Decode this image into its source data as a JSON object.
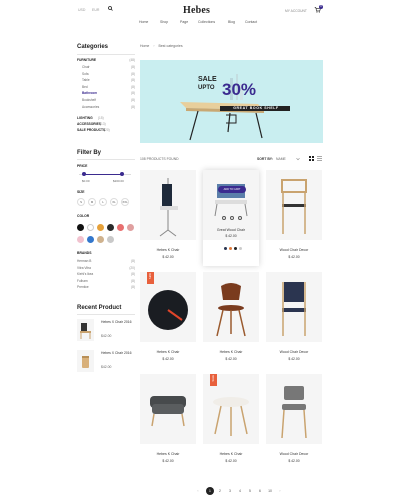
{
  "topbar": {
    "lang": "USD",
    "curr": "EUR",
    "logo": "Hebes",
    "account": "MY ACCOUNT",
    "cart_count": "0",
    "nav": [
      "Home",
      "Shop",
      "Page",
      "Collections",
      "Blog",
      "Contact"
    ]
  },
  "breadcrumb": {
    "home": "Home",
    "current": "Best categories"
  },
  "sidebar": {
    "categories_title": "Categories",
    "furniture": "FURNITURE",
    "furniture_count": "(48)",
    "subcats": [
      {
        "label": "Chair",
        "count": "(8)"
      },
      {
        "label": "Sofa",
        "count": "(8)"
      },
      {
        "label": "Table",
        "count": "(8)"
      },
      {
        "label": "Bed",
        "count": "(8)"
      },
      {
        "label": "Bathroom",
        "count": "(8)"
      },
      {
        "label": "Bookshelf",
        "count": "(8)"
      },
      {
        "label": "Accessories",
        "count": "(8)"
      }
    ],
    "other_cats": [
      {
        "label": "LIGHTING",
        "count": "(15)"
      },
      {
        "label": "ACCESSORIES",
        "count": "(13)"
      },
      {
        "label": "SALE PRODUCTS",
        "count": "(20)"
      }
    ],
    "filter_title": "Filter By",
    "price_label": "PRICE",
    "price_min": "$0.00",
    "price_max": "$200.00",
    "size_label": "SIZE",
    "sizes": [
      "S",
      "M",
      "L",
      "XL",
      "XXL"
    ],
    "color_label": "COLOR",
    "colors": [
      "#111111",
      "#ffffff",
      "#e6a13a",
      "#2a2a2a",
      "#e86f6f",
      "#e0a0a0",
      "#f1c2cf",
      "#3377cc",
      "#cfb28e",
      "#c9c9c9"
    ],
    "brands_label": "BRANDS",
    "brands": [
      {
        "label": "Herman B",
        "count": "(8)"
      },
      {
        "label": "Vitra Vitra",
        "count": "(20)"
      },
      {
        "label": "Kiehl's Ikea",
        "count": "(8)"
      },
      {
        "label": "Fulham",
        "count": "(8)"
      },
      {
        "label": "Prentice",
        "count": "(8)"
      }
    ],
    "recent_title": "Recent Product",
    "recent": [
      {
        "name": "Hebes X Chair 2016",
        "price": "$42.00"
      },
      {
        "name": "Hebes X Chair 2016",
        "price": "$42.00"
      }
    ]
  },
  "banner": {
    "line1": "SALE",
    "line2": "UPTO",
    "pct": "30%",
    "sub": "GREAT BOOK SHELF"
  },
  "toolbar": {
    "found": "108 PRODUCTS FOUND",
    "sortby": "SORT BY:",
    "sortval": "NAME"
  },
  "products": [
    {
      "name": "Hebes K Chair",
      "price": "$ 42.00"
    },
    {
      "name": "Great Wood Chair",
      "price": "$ 42.00",
      "cta": "ADD TO CART"
    },
    {
      "name": "Wood Chair Decor",
      "price": "$ 42.00"
    },
    {
      "name": "Hebes K Chair",
      "price": "$ 42.00",
      "badge": "NEW"
    },
    {
      "name": "Hebes K Chair",
      "price": "$ 42.00"
    },
    {
      "name": "Wood Chair Decor",
      "price": "$ 42.00"
    },
    {
      "name": "Hebes K Chair",
      "price": "$ 42.00"
    },
    {
      "name": "Hebes K Chair",
      "price": "$ 42.00",
      "badge": "SALE"
    },
    {
      "name": "Wood Chair Decor",
      "price": "$ 42.00"
    }
  ],
  "pagination": [
    "1",
    "2",
    "3",
    "4",
    "5",
    "6",
    "10"
  ],
  "accent": "#3b2b8f",
  "banner_bg": "#c9eef0"
}
